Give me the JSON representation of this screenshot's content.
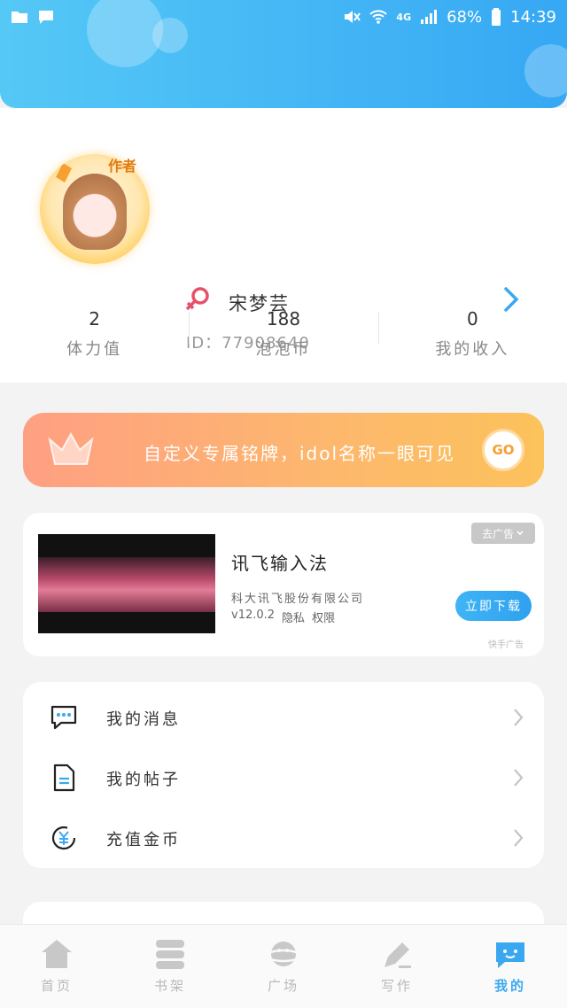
{
  "status_bar": {
    "battery": "68%",
    "network": "4G",
    "time": "14:39"
  },
  "profile": {
    "avatar_badge": "作者",
    "name": "宋梦芸",
    "id_text": "ID：77908640",
    "stats": [
      {
        "value": "2",
        "label": "体力值"
      },
      {
        "value": "188",
        "label": "泡泡币"
      },
      {
        "value": "0",
        "label": "我的收入"
      }
    ]
  },
  "promo": {
    "text": "自定义专属铭牌，idol名称一眼可见",
    "go_label": "GO"
  },
  "ad": {
    "close_label": "去广告",
    "title": "讯飞输入法",
    "company": "科大讯飞股份有限公司",
    "version": "v12.0.2",
    "privacy": "隐私",
    "permissions": "权限",
    "download_label": "立即下载",
    "source": "快手广告"
  },
  "menu": [
    {
      "label": "我的消息",
      "icon": "chat-bubble-icon"
    },
    {
      "label": "我的帖子",
      "icon": "document-icon"
    },
    {
      "label": "充值金币",
      "icon": "yuan-coin-icon"
    }
  ],
  "tabbar": [
    {
      "label": "首页",
      "icon": "home-icon",
      "active": false
    },
    {
      "label": "书架",
      "icon": "bookshelf-icon",
      "active": false
    },
    {
      "label": "广场",
      "icon": "planet-icon",
      "active": false
    },
    {
      "label": "写作",
      "icon": "pen-icon",
      "active": false
    },
    {
      "label": "我的",
      "icon": "chat-face-icon",
      "active": true
    }
  ],
  "colors": {
    "accent": "#3aa8f0",
    "header_start": "#55c8f6",
    "header_end": "#36a8f4",
    "promo_start": "#fe9f82",
    "promo_end": "#fcc25b",
    "gender": "#e8506a"
  }
}
